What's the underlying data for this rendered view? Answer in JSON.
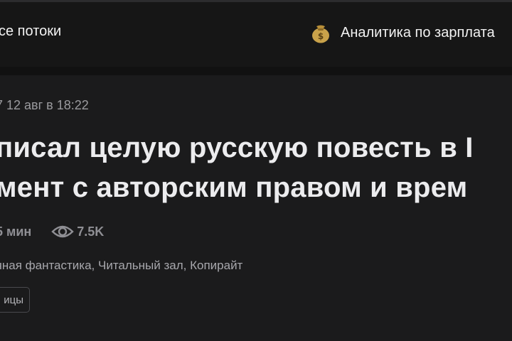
{
  "header": {
    "nav_all_label": "се потоки",
    "salary_icon": "money-bag-icon",
    "salary_label": "Аналитика по зарплата"
  },
  "article": {
    "published": "7 12 авг в 18:22",
    "title_line_1": "писал целую русскую повесть в I",
    "title_line_2": "мент с авторским правом и врем",
    "read_time": "5 мин",
    "views_icon": "eye-icon",
    "views": "7.5K",
    "hubs": "чная фантастика, Читальный зал, Копирайт",
    "badge": "ицы"
  },
  "colors": {
    "background": "#1b1b1c",
    "topbar": "#161616",
    "title": "#ececee",
    "meta": "#9a9a9e"
  }
}
